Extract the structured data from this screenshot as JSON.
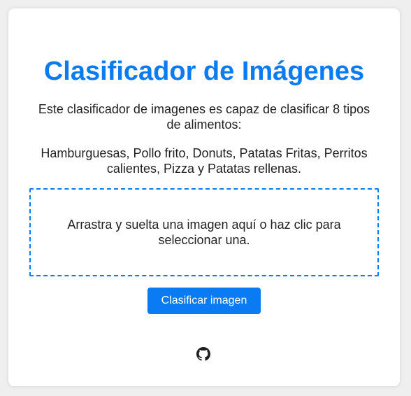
{
  "header": {
    "title": "Clasificador de Imágenes"
  },
  "description": {
    "intro": "Este clasificador de imagenes es capaz de clasificar 8 tipos de alimentos:",
    "categories": "Hamburguesas, Pollo frito, Donuts, Patatas Fritas, Perritos calientes, Pizza y Patatas rellenas."
  },
  "dropzone": {
    "text": "Arrastra y suelta una imagen aquí o haz clic para seleccionar una."
  },
  "actions": {
    "classify_label": "Clasificar imagen"
  },
  "footer": {
    "icon": "github-icon"
  },
  "colors": {
    "accent": "#0a7bf2",
    "background": "#efefef",
    "card": "#ffffff",
    "text": "#1f1f1f"
  }
}
